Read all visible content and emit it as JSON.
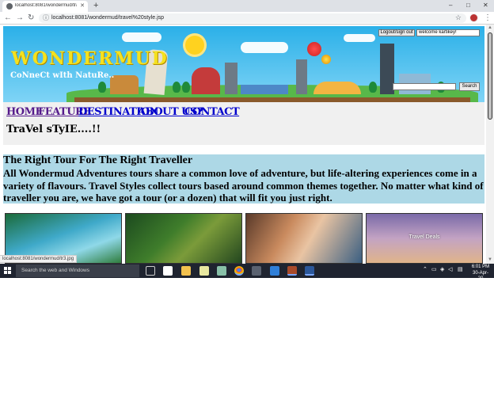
{
  "browser": {
    "tab_title": "localhost:8081/wondermud/trav",
    "url": "localhost:8081/wondermud/travel%20style.jsp",
    "new_tab": "+",
    "controls": {
      "minimize": "–",
      "maximize": "□",
      "close": "✕"
    },
    "nav": {
      "back": "←",
      "forward": "→",
      "reload": "↻"
    },
    "info_icon": "ⓘ",
    "star": "☆",
    "menu": "⋮"
  },
  "header": {
    "logo": "WONDERMUD",
    "tagline": "CoNneCt wIth NatuRe..",
    "logout_label": "Logout/sign out",
    "welcome_value": "welcome kartikey!",
    "search_value": "",
    "search_label": "Search"
  },
  "nav": {
    "items": [
      {
        "label": "HOME"
      },
      {
        "label": "FEATURE"
      },
      {
        "label": "DESTINATION"
      },
      {
        "label": "ABOUT US?"
      },
      {
        "label": "CONTACT"
      }
    ]
  },
  "page": {
    "section_title": "TraVel sTyIE....!!",
    "intro_heading": "The Right Tour For The Right Traveller",
    "intro_text": "All Wondermud Adventures tours share a common love of adventure, but life-altering experiences come in a variety of flavours. Travel Styles collect tours based around common themes together. No matter what kind of traveller you are, we have got a tour (or a dozen) that will fit you just right.",
    "thumb_caption": "Travel Deals"
  },
  "status_url": "localhost:8081/wondermud/tr3.jpg",
  "taskbar": {
    "search_placeholder": "Search the web and Windows",
    "time": "6:01 PM",
    "date": "30-Apr-20"
  },
  "colors": {
    "intro_bg": "#add8e6",
    "nav_bg": "#f0f0f0",
    "link": "#0000cc",
    "visited_link": "#551a8b",
    "taskbar": "#1f2430"
  }
}
